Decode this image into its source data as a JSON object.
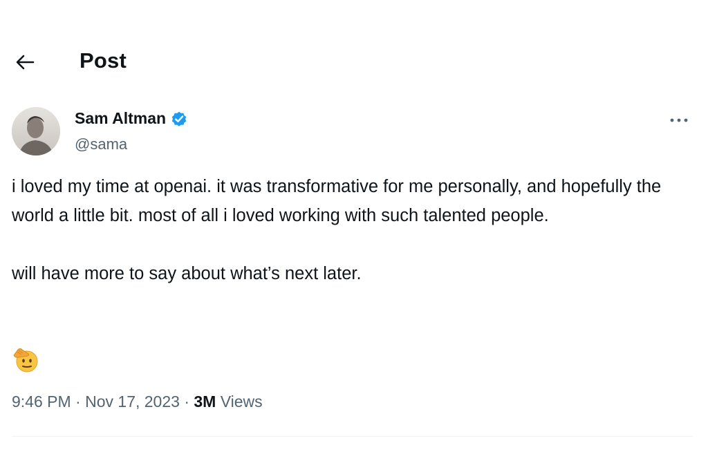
{
  "header": {
    "title": "Post",
    "back_icon": "arrow-left-icon"
  },
  "post": {
    "author": {
      "name": "Sam Altman",
      "handle": "@sama",
      "verified": true,
      "verified_color": "#1d9bf0"
    },
    "paragraphs": [
      "i loved my time at openai. it was transformative for me personally, and hopefully the world a little bit. most of all i loved working with such talented people.",
      "will have more to say about what’s next later."
    ],
    "emoji": "saluting-face",
    "timestamp": "9:46 PM",
    "date": "Nov 17, 2023",
    "separator": "·",
    "views_count": "3M",
    "views_label": "Views"
  },
  "colors": {
    "text_primary": "#0f1419",
    "text_secondary": "#536471",
    "divider": "#eff3f4",
    "accent": "#1d9bf0"
  }
}
